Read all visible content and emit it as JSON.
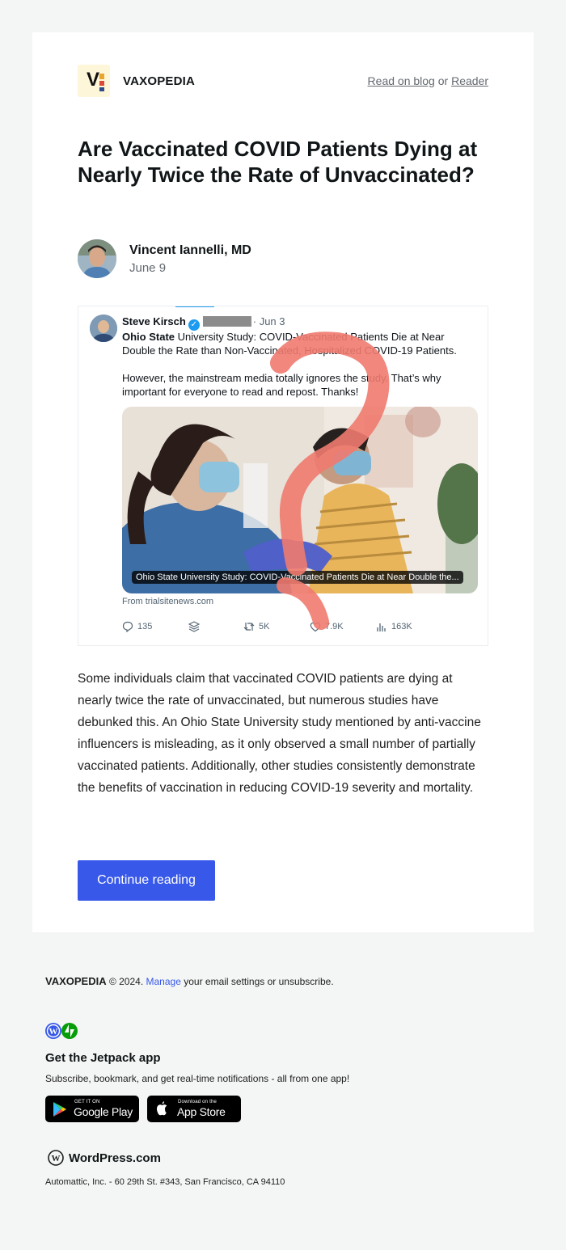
{
  "header": {
    "site_name": "VAXOPEDIA",
    "logo_letter": "V",
    "read_on_blog": "Read on blog",
    "or": "or",
    "reader": "Reader"
  },
  "post": {
    "title": "Are Vaccinated COVID Patients Dying at Nearly Twice the Rate of Unvaccinated?",
    "author": "Vincent Iannelli, MD",
    "date": "June 9",
    "summary": "Some individuals claim that vaccinated COVID patients are dying at nearly twice the rate of unvaccinated, but numerous studies have debunked this. An Ohio State University study mentioned by anti-vaccine influencers is misleading, as it only observed a small number of partially vaccinated patients. Additionally, other studies consistently demonstrate the benefits of vaccination in reducing COVID-19 severity and mortality.",
    "continue_label": "Continue reading"
  },
  "tweet": {
    "author": "Steve Kirsch",
    "date": "· Jun 3",
    "text_bold": "Ohio State",
    "text_1": " University Study: COVID-Vaccinated Patients Die at Near Double the Rate than Non-Vaccinated, Hospitalized COVID-19 Patients.",
    "text_2": "However, the mainstream media totally ignores the study.  That’s why important for everyone to read and repost. Thanks!",
    "media_caption": "Ohio State University Study: COVID-Vaccinated Patients Die at Near Double the...",
    "source": "From trialsitenews.com",
    "replies": "135",
    "retweets": "5K",
    "likes": "7.9K",
    "views": "163K"
  },
  "footer": {
    "site_name": "VAXOPEDIA",
    "copyright": "© 2024.",
    "manage": "Manage",
    "manage_rest": "your email settings or unsubscribe.",
    "jetpack_title": "Get the Jetpack app",
    "jetpack_sub": "Subscribe, bookmark, and get real-time notifications - all from one app!",
    "google_small": "GET IT ON",
    "google_big": "Google Play",
    "apple_small": "Download on the",
    "apple_big": "App Store",
    "wp_brand": "WordPress.com",
    "address": "Automattic, Inc. - 60 29th St. #343, San Francisco, CA 94110"
  },
  "colors": {
    "accent": "#3858e9",
    "page_bg": "#f4f6f5",
    "overlay_question_mark": "#f07a6f"
  }
}
